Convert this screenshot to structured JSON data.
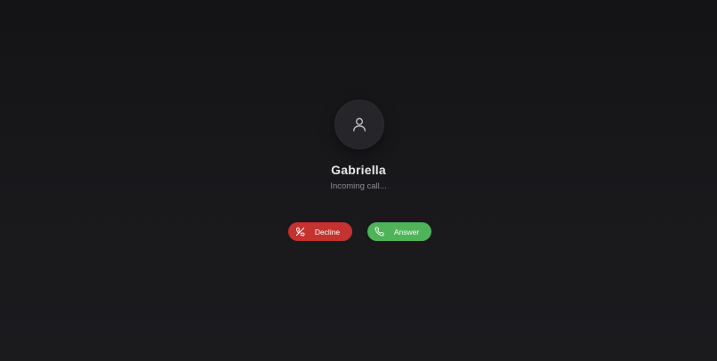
{
  "caller": {
    "name": "Gabriella",
    "status": "Incoming call...",
    "avatar_icon": "user-icon"
  },
  "actions": {
    "decline": {
      "label": "Decline",
      "icon": "phone-off-icon",
      "color": "#c4332f"
    },
    "answer": {
      "label": "Answer",
      "icon": "phone-icon",
      "color": "#4fb35a"
    }
  },
  "theme": {
    "background": "#17171a",
    "avatar_bg": "#26262a",
    "text_primary": "#e6e6e8",
    "text_secondary": "#8d8d93"
  }
}
